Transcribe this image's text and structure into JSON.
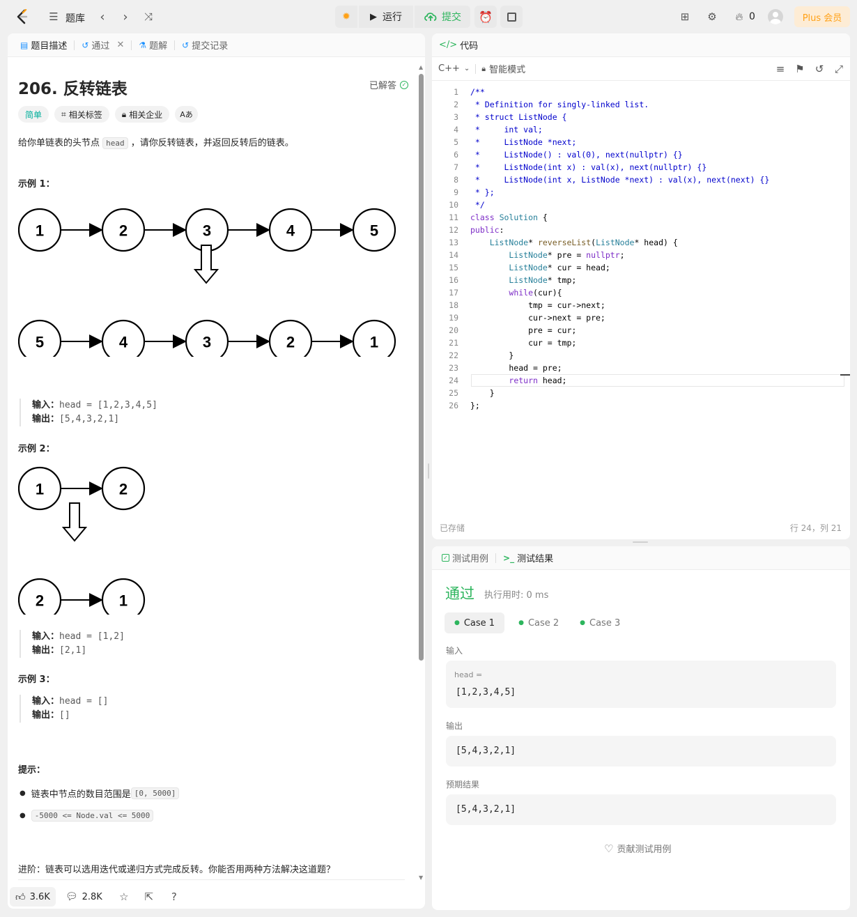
{
  "topbar": {
    "problem_bank": "题库",
    "run_label": "运行",
    "submit_label": "提交",
    "streak_count": "0",
    "plus_label": "Plus 会员",
    "accent_submit": "#2db55d",
    "plus_color": "#ffa116"
  },
  "left_tabs": [
    {
      "label": "题目描述",
      "icon": "doc-icon"
    },
    {
      "label": "通过",
      "icon": "history-icon"
    },
    {
      "label": "题解",
      "icon": "flask-icon"
    },
    {
      "label": "提交记录",
      "icon": "history-icon"
    }
  ],
  "problem": {
    "title": "206. 反转链表",
    "solved_label": "已解答",
    "difficulty": "简单",
    "tag_related": "相关标签",
    "tag_company": "相关企业",
    "translate_icon": "Aあ",
    "desc_before": "给你单链表的头节点 ",
    "desc_code": "head",
    "desc_after": " ，请你反转链表，并返回反转后的链表。",
    "examples": [
      {
        "title": "示例 1：",
        "input_label": "输入：",
        "input": "head = [1,2,3,4,5]",
        "output_label": "输出：",
        "output": "[5,4,3,2,1]"
      },
      {
        "title": "示例 2：",
        "input_label": "输入：",
        "input": "head = [1,2]",
        "output_label": "输出：",
        "output": "[2,1]"
      },
      {
        "title": "示例 3：",
        "input_label": "输入：",
        "input": "head = []",
        "output_label": "输出：",
        "output": "[]"
      }
    ],
    "diagram1_top": [
      "1",
      "2",
      "3",
      "4",
      "5"
    ],
    "diagram1_bottom": [
      "5",
      "4",
      "3",
      "2",
      "1"
    ],
    "diagram2_top": [
      "1",
      "2"
    ],
    "diagram2_bottom": [
      "2",
      "1"
    ],
    "hints_title": "提示：",
    "hint1_text": "链表中节点的数目范围是 ",
    "hint1_code": "[0, 5000]",
    "hint2_code": "-5000 <= Node.val <= 5000",
    "advanced": "进阶：链表可以选用迭代或递归方式完成反转。你能否用两种方法解决这道题？",
    "likes": "3.6K",
    "comments": "2.8K"
  },
  "editor": {
    "header": "代码",
    "language": "C++",
    "mode": "智能模式",
    "saved": "已存储",
    "cursor": "行 24，列 21",
    "line_numbers": [
      "1",
      "2",
      "3",
      "4",
      "5",
      "6",
      "7",
      "8",
      "9",
      "10",
      "11",
      "12",
      "13",
      "14",
      "15",
      "16",
      "17",
      "18",
      "19",
      "20",
      "21",
      "22",
      "23",
      "24",
      "25",
      "26"
    ],
    "lines": [
      "/**",
      " * Definition for singly-linked list.",
      " * struct ListNode {",
      " *     int val;",
      " *     ListNode *next;",
      " *     ListNode() : val(0), next(nullptr) {}",
      " *     ListNode(int x) : val(x), next(nullptr) {}",
      " *     ListNode(int x, ListNode *next) : val(x), next(next) {}",
      " * };",
      " */",
      "class Solution {",
      "public:",
      "    ListNode* reverseList(ListNode* head) {",
      "        ListNode* pre = nullptr;",
      "        ListNode* cur = head;",
      "        ListNode* tmp;",
      "        while(cur){",
      "            tmp = cur->next;",
      "            cur->next = pre;",
      "            pre = cur;",
      "            cur = tmp;",
      "        }",
      "        head = pre;",
      "        return head;",
      "    }",
      "};"
    ]
  },
  "results": {
    "tab_cases": "测试用例",
    "tab_results": "测试结果",
    "status": "通过",
    "runtime": "执行用时: 0 ms",
    "cases": [
      "Case 1",
      "Case 2",
      "Case 3"
    ],
    "input_label": "输入",
    "input_var": "head =",
    "input_value": "[1,2,3,4,5]",
    "output_label": "输出",
    "output_value": "[5,4,3,2,1]",
    "expected_label": "预期结果",
    "expected_value": "[5,4,3,2,1]",
    "contribute": "贡献测试用例",
    "status_color": "#2db55d"
  }
}
